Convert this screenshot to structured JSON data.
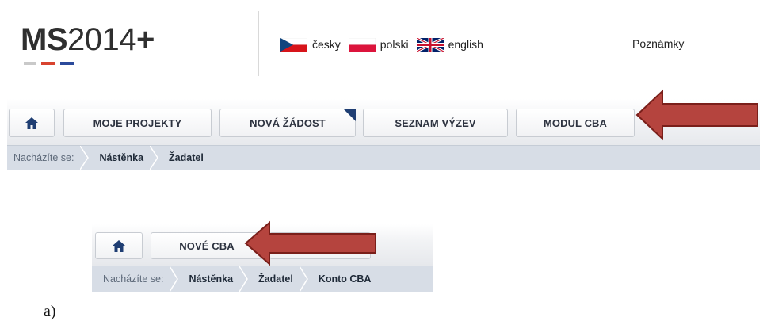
{
  "header": {
    "logo": {
      "bold": "MS",
      "light": "2014",
      "plus": "+"
    },
    "languages": [
      {
        "label": "česky",
        "flag": "cz-flag-icon"
      },
      {
        "label": "polski",
        "flag": "pl-flag-icon"
      },
      {
        "label": "english",
        "flag": "uk-flag-icon"
      }
    ],
    "notes": "Poznámky"
  },
  "nav1": {
    "buttons": [
      "MOJE PROJEKTY",
      "NOVÁ ŽÁDOST",
      "SEZNAM VÝZEV",
      "MODUL CBA"
    ],
    "breadcrumb": [
      "Nacházíte se:",
      "Nástěnka",
      "Žadatel"
    ]
  },
  "nav2": {
    "buttons": [
      "NOVÉ CBA"
    ],
    "breadcrumb": [
      "Nacházíte se:",
      "Nástěnka",
      "Žadatel",
      "Konto CBA"
    ]
  },
  "caption": "a)",
  "colors": {
    "arrow": "#b5443e",
    "arrow_border": "#7a1f1a",
    "logo_red": "#d8432f",
    "logo_blue": "#2b4a9b",
    "logo_gray": "#9b9b9b",
    "breadcrumb_bg": "#d7dde6",
    "corner_flag": "#1f3e73"
  }
}
